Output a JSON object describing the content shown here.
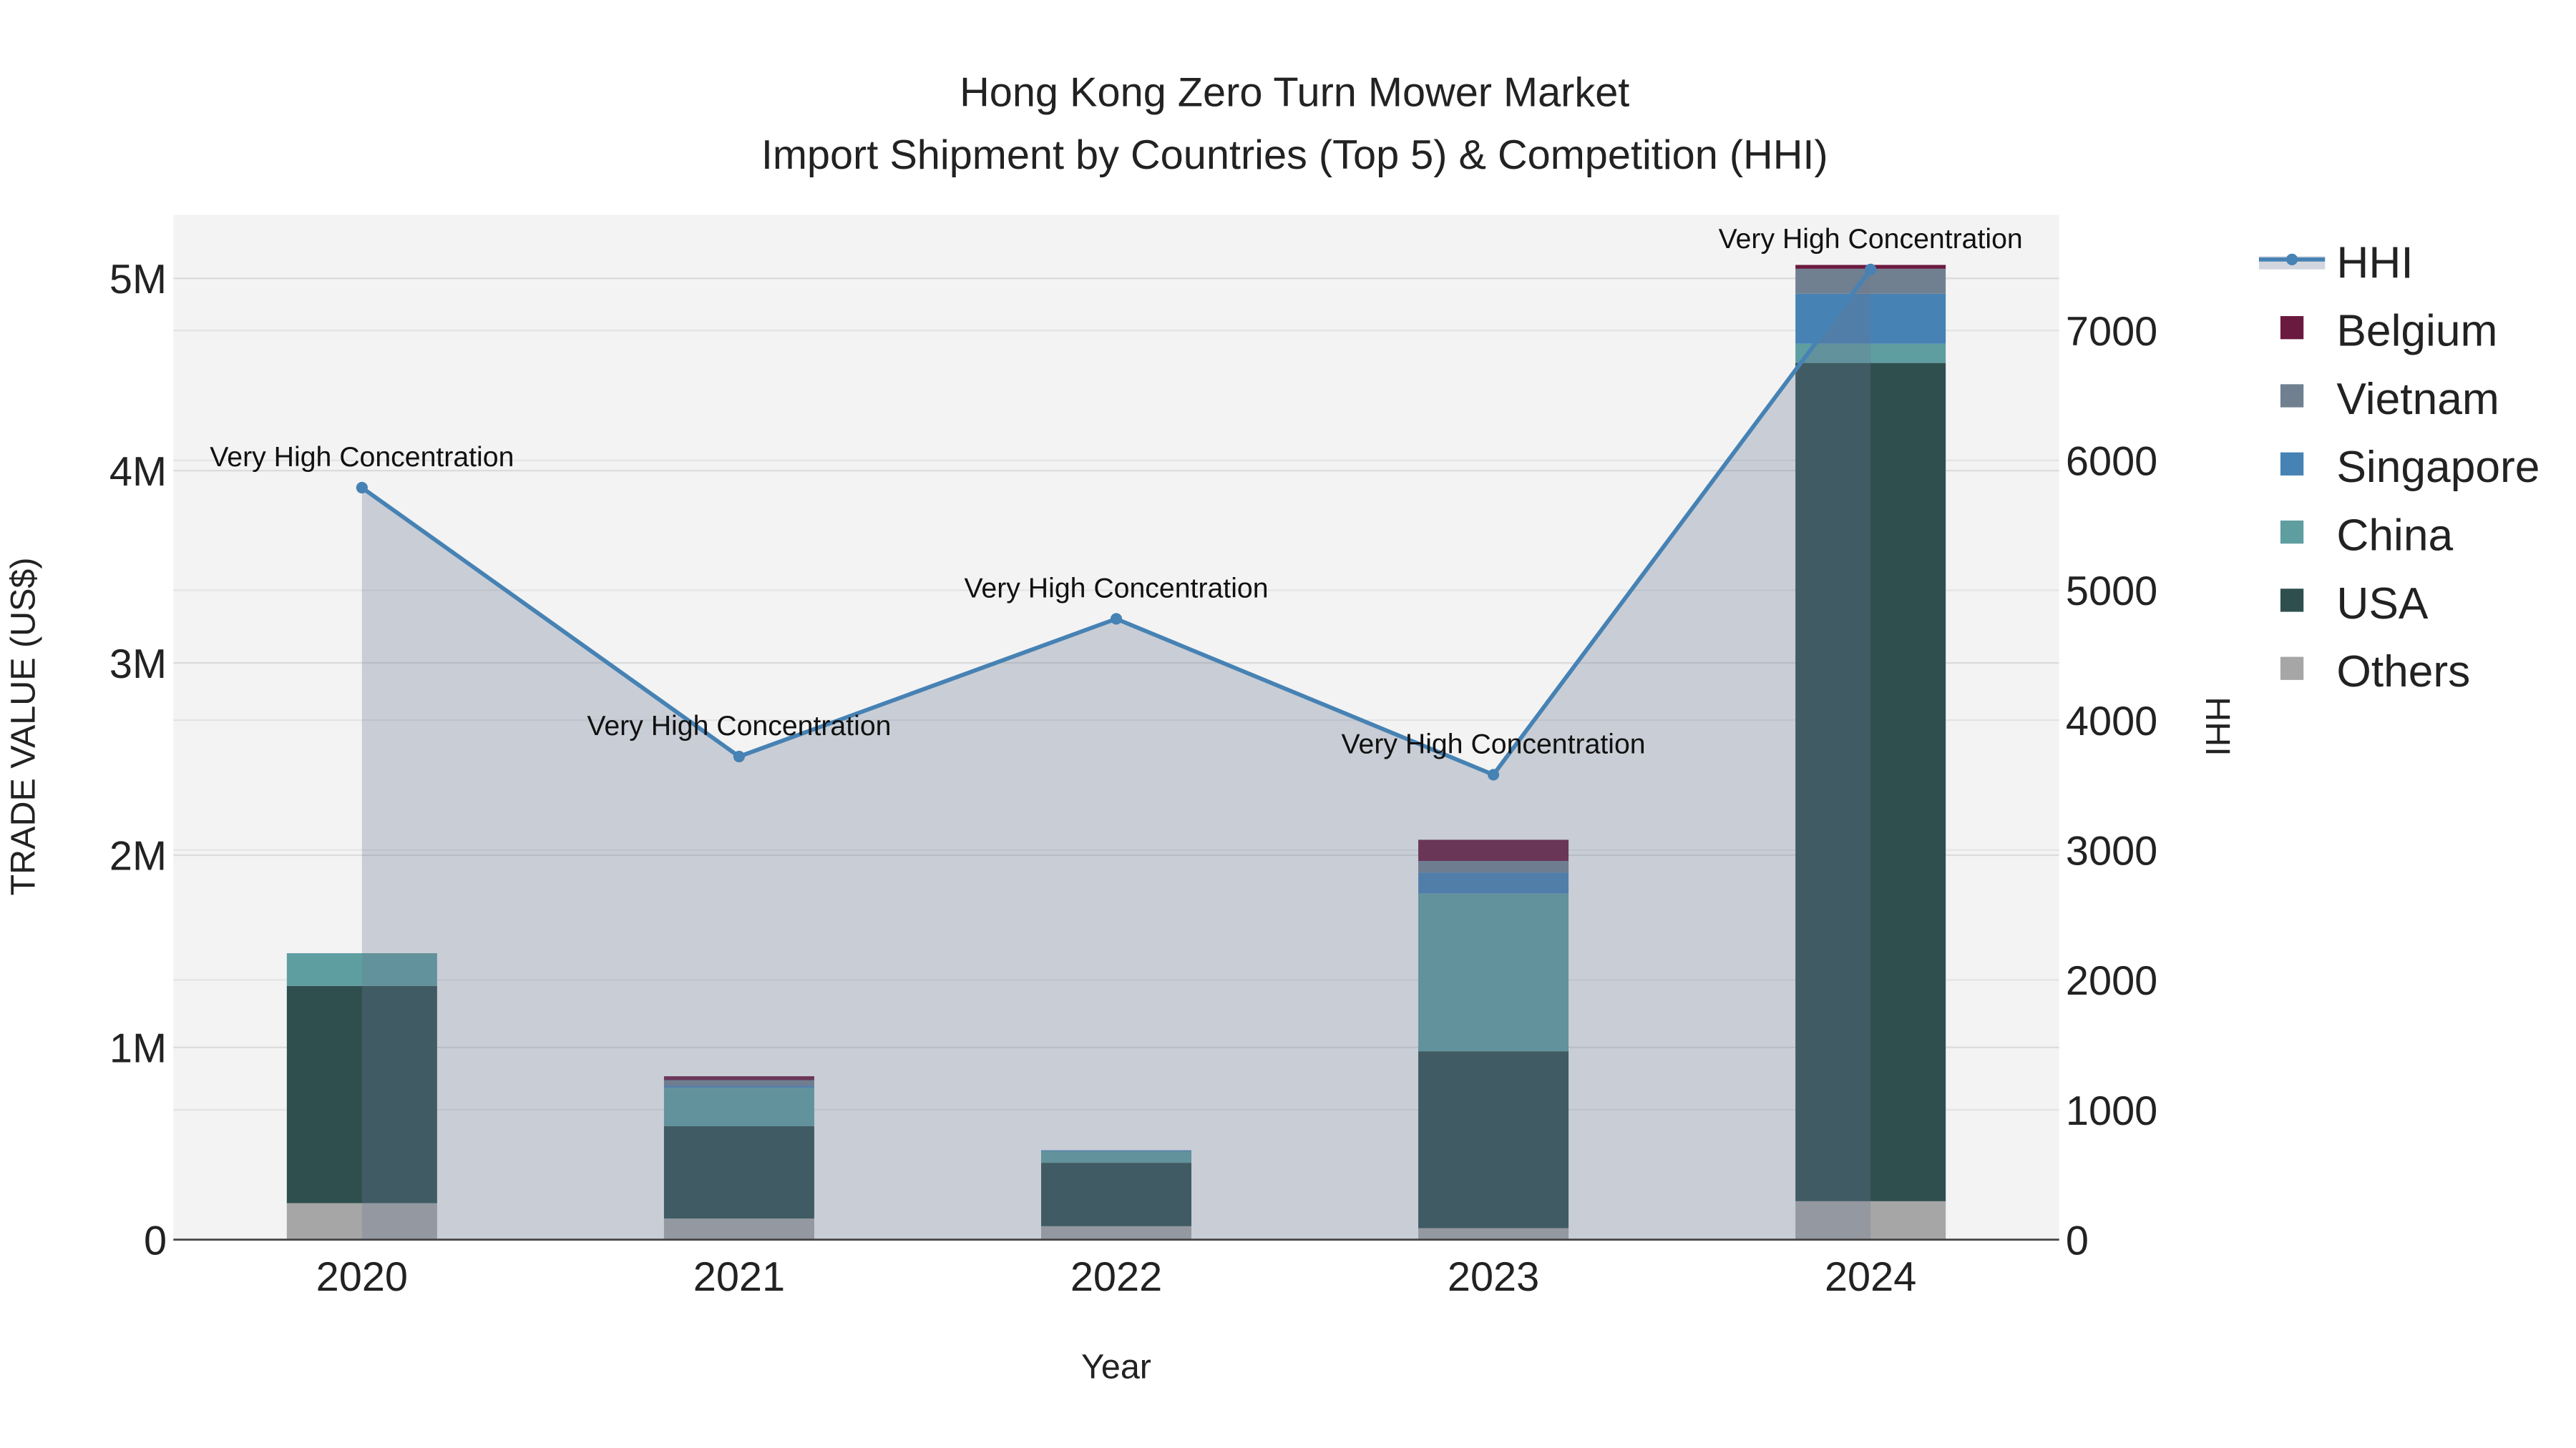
{
  "chart_data": {
    "type": "bar",
    "title": "Hong Kong Zero Turn Mower Market",
    "subtitle": "Import Shipment by Countries (Top 5) & Competition (HHI)",
    "xlabel": "Year",
    "ylabel": "TRADE VALUE (US$)",
    "y2label": "HHI",
    "categories": [
      "2020",
      "2021",
      "2022",
      "2023",
      "2024"
    ],
    "ylim": [
      0,
      5330000
    ],
    "y2lim": [
      0,
      7890
    ],
    "yticks": [
      0,
      1000000,
      2000000,
      3000000,
      4000000,
      5000000
    ],
    "ytick_labels": [
      "0",
      "1M",
      "2M",
      "3M",
      "4M",
      "5M"
    ],
    "y2ticks": [
      0,
      1000,
      2000,
      3000,
      4000,
      5000,
      6000,
      7000
    ],
    "y2tick_labels": [
      "0",
      "1000",
      "2000",
      "3000",
      "4000",
      "5000",
      "6000",
      "7000"
    ],
    "grid": true,
    "legend_position": "right",
    "series": [
      {
        "name": "Others",
        "color": "#a6a6a6",
        "values": [
          190000,
          110000,
          70000,
          60000,
          200000
        ]
      },
      {
        "name": "USA",
        "color": "#2f4f4f",
        "values": [
          1130000,
          480000,
          330000,
          920000,
          4360000
        ]
      },
      {
        "name": "China",
        "color": "#5f9ea0",
        "values": [
          170000,
          200000,
          60000,
          820000,
          100000
        ]
      },
      {
        "name": "Singapore",
        "color": "#4682b4",
        "values": [
          0,
          10000,
          5000,
          110000,
          260000
        ]
      },
      {
        "name": "Vietnam",
        "color": "#708090",
        "values": [
          0,
          30000,
          0,
          60000,
          130000
        ]
      },
      {
        "name": "Belgium",
        "color": "#6b1a3f",
        "values": [
          0,
          20000,
          0,
          110000,
          20000
        ]
      }
    ],
    "hhi": {
      "name": "HHI",
      "color": "#4682b4",
      "values": [
        5790,
        3720,
        4780,
        3580,
        7470
      ],
      "annotations": [
        "Very High Concentration",
        "Very High Concentration",
        "Very High Concentration",
        "Very High Concentration",
        "Very High Concentration"
      ]
    },
    "legend_order": [
      "HHI",
      "Belgium",
      "Vietnam",
      "Singapore",
      "China",
      "USA",
      "Others"
    ]
  }
}
